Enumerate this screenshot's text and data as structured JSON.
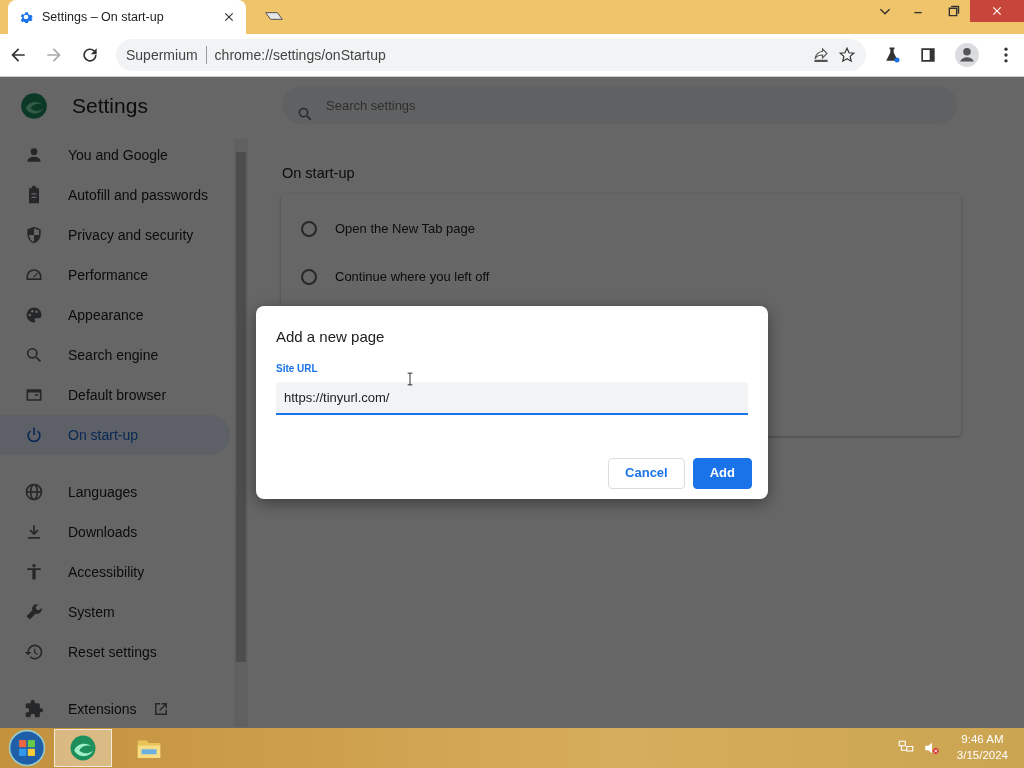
{
  "browser": {
    "tabs": [
      {
        "title": "Settings – On start-up",
        "selected": true
      }
    ],
    "address": {
      "site": "Supermium",
      "url": "chrome://settings/onStartup"
    }
  },
  "settings": {
    "title": "Settings",
    "search": {
      "placeholder": "Search settings"
    },
    "sidebar": {
      "sections": [
        {
          "items": [
            {
              "label": "You and Google",
              "kind": "person",
              "selected": false
            },
            {
              "label": "Autofill and passwords",
              "kind": "clipboard",
              "selected": false
            },
            {
              "label": "Privacy and security",
              "kind": "shield",
              "selected": false
            },
            {
              "label": "Performance",
              "kind": "gauge",
              "selected": false
            },
            {
              "label": "Appearance",
              "kind": "palette",
              "selected": false
            },
            {
              "label": "Search engine",
              "kind": "search",
              "selected": false
            },
            {
              "label": "Default browser",
              "kind": "browser",
              "selected": false
            },
            {
              "label": "On start-up",
              "kind": "power",
              "selected": true
            }
          ]
        },
        {
          "items": [
            {
              "label": "Languages",
              "kind": "globe",
              "selected": false
            },
            {
              "label": "Downloads",
              "kind": "download",
              "selected": false
            },
            {
              "label": "Accessibility",
              "kind": "accessibility",
              "selected": false
            },
            {
              "label": "System",
              "kind": "wrench",
              "selected": false
            },
            {
              "label": "Reset settings",
              "kind": "history",
              "selected": false
            }
          ]
        },
        {
          "items": [
            {
              "label": "Extensions",
              "kind": "extensions",
              "selected": false
            }
          ]
        }
      ]
    },
    "section_title": "On start-up",
    "options": [
      {
        "label": "Open the New Tab page",
        "selected": false
      },
      {
        "label": "Continue where you left off",
        "selected": false
      }
    ]
  },
  "dialog": {
    "title": "Add a new page",
    "field": {
      "label": "Site URL",
      "value": "https://tinyurl.com/"
    },
    "buttons": [
      {
        "label": "Cancel",
        "kind": "secondary"
      },
      {
        "label": "Add",
        "kind": "primary"
      }
    ]
  },
  "taskbar": {
    "time": "9:46 AM",
    "date": "3/15/2024"
  }
}
